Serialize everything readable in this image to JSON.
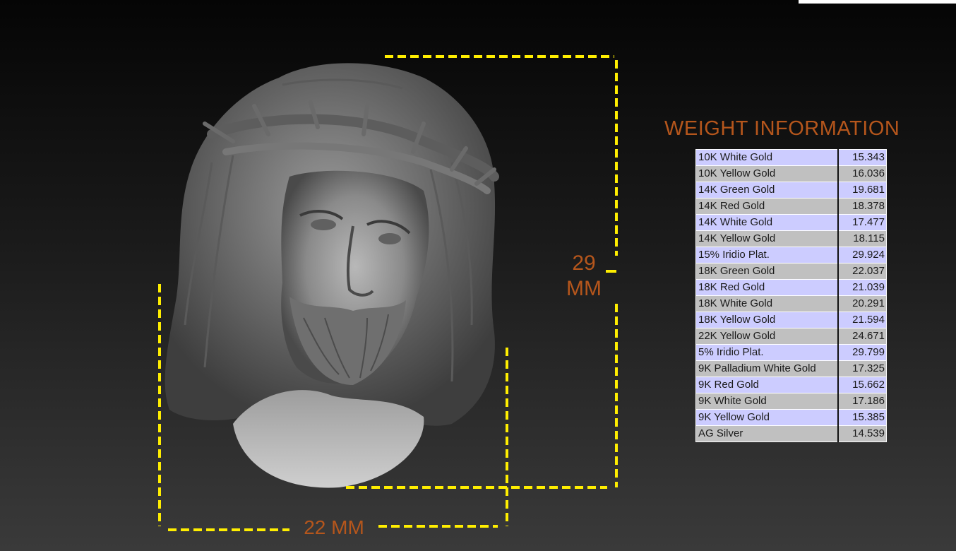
{
  "dimensions": {
    "height_value": "29",
    "height_unit": "MM",
    "width_label": "22 MM"
  },
  "weight_info": {
    "title": "WEIGHT INFORMATION",
    "rows": [
      {
        "metal": "10K White Gold",
        "weight": "15.343"
      },
      {
        "metal": "10K Yellow Gold",
        "weight": "16.036"
      },
      {
        "metal": "14K Green Gold",
        "weight": "19.681"
      },
      {
        "metal": "14K Red Gold",
        "weight": "18.378"
      },
      {
        "metal": "14K White Gold",
        "weight": "17.477"
      },
      {
        "metal": "14K Yellow Gold",
        "weight": "18.115"
      },
      {
        "metal": "15% Iridio Plat.",
        "weight": "29.924"
      },
      {
        "metal": "18K Green Gold",
        "weight": "22.037"
      },
      {
        "metal": "18K Red Gold",
        "weight": "21.039"
      },
      {
        "metal": "18K White Gold",
        "weight": "20.291"
      },
      {
        "metal": "18K Yellow Gold",
        "weight": "21.594"
      },
      {
        "metal": "22K Yellow Gold",
        "weight": "24.671"
      },
      {
        "metal": "5% Iridio Plat.",
        "weight": "29.799"
      },
      {
        "metal": "9K Palladium White Gold",
        "weight": "17.325"
      },
      {
        "metal": "9K Red Gold",
        "weight": "15.662"
      },
      {
        "metal": "9K White Gold",
        "weight": "17.186"
      },
      {
        "metal": "9K Yellow Gold",
        "weight": "15.385"
      },
      {
        "metal": "AG Silver",
        "weight": "14.539"
      }
    ]
  },
  "colors": {
    "accent_text": "#b5561c",
    "dimension_line": "#ffee00",
    "row_odd": "#ccccff",
    "row_even": "#c0c0c0"
  }
}
